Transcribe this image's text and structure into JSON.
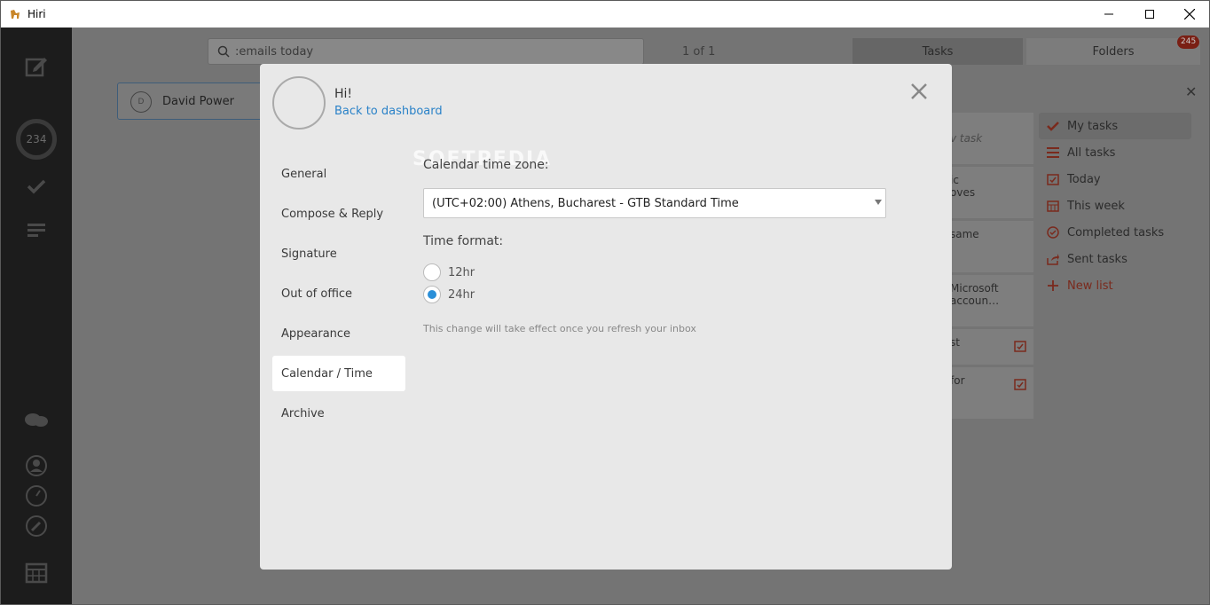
{
  "window": {
    "title": "Hiri",
    "minimize_icon": "minimize-icon",
    "maximize_icon": "maximize-icon",
    "close_icon": "close-icon"
  },
  "rail": {
    "unread_count": "234"
  },
  "background": {
    "search_value": ":emails today",
    "pager": "1 of 1",
    "tabs": {
      "tasks": "Tasks",
      "folders": "Folders",
      "folders_badge": "245"
    },
    "contact": {
      "initial": "D",
      "name": "David Power"
    },
    "task_cards": [
      {
        "text": "v task"
      },
      {
        "text": "ic\noves"
      },
      {
        "text": "same"
      },
      {
        "text": "Microsoft\naccoun…"
      },
      {
        "text": "st"
      },
      {
        "text": "for"
      }
    ],
    "sidebar": [
      {
        "label": "My tasks",
        "icon": "check-icon"
      },
      {
        "label": "All tasks",
        "icon": "list-icon"
      },
      {
        "label": "Today",
        "icon": "calendar-check-icon"
      },
      {
        "label": "This week",
        "icon": "calendar-grid-icon"
      },
      {
        "label": "Completed tasks",
        "icon": "check-circle-icon"
      },
      {
        "label": "Sent tasks",
        "icon": "share-icon"
      },
      {
        "label": "New list",
        "icon": "plus-icon"
      }
    ]
  },
  "modal": {
    "greeting": "Hi!",
    "back_link": "Back to dashboard",
    "nav": [
      {
        "label": "General"
      },
      {
        "label": "Compose & Reply"
      },
      {
        "label": "Signature"
      },
      {
        "label": "Out of office"
      },
      {
        "label": "Appearance"
      },
      {
        "label": "Calendar / Time",
        "active": true
      },
      {
        "label": "Archive"
      }
    ],
    "timezone_label": "Calendar time zone:",
    "timezone_value": "(UTC+02:00) Athens, Bucharest - GTB Standard Time",
    "time_format_label": "Time format:",
    "time_formats": [
      {
        "label": "12hr",
        "selected": false
      },
      {
        "label": "24hr",
        "selected": true
      }
    ],
    "note": "This change will take effect once you refresh your inbox",
    "watermark": "SOFTPEDIA"
  },
  "colors": {
    "accent": "#2a82c8",
    "radio_selected": "#2a8fd8",
    "brand_red": "#c0392b"
  }
}
